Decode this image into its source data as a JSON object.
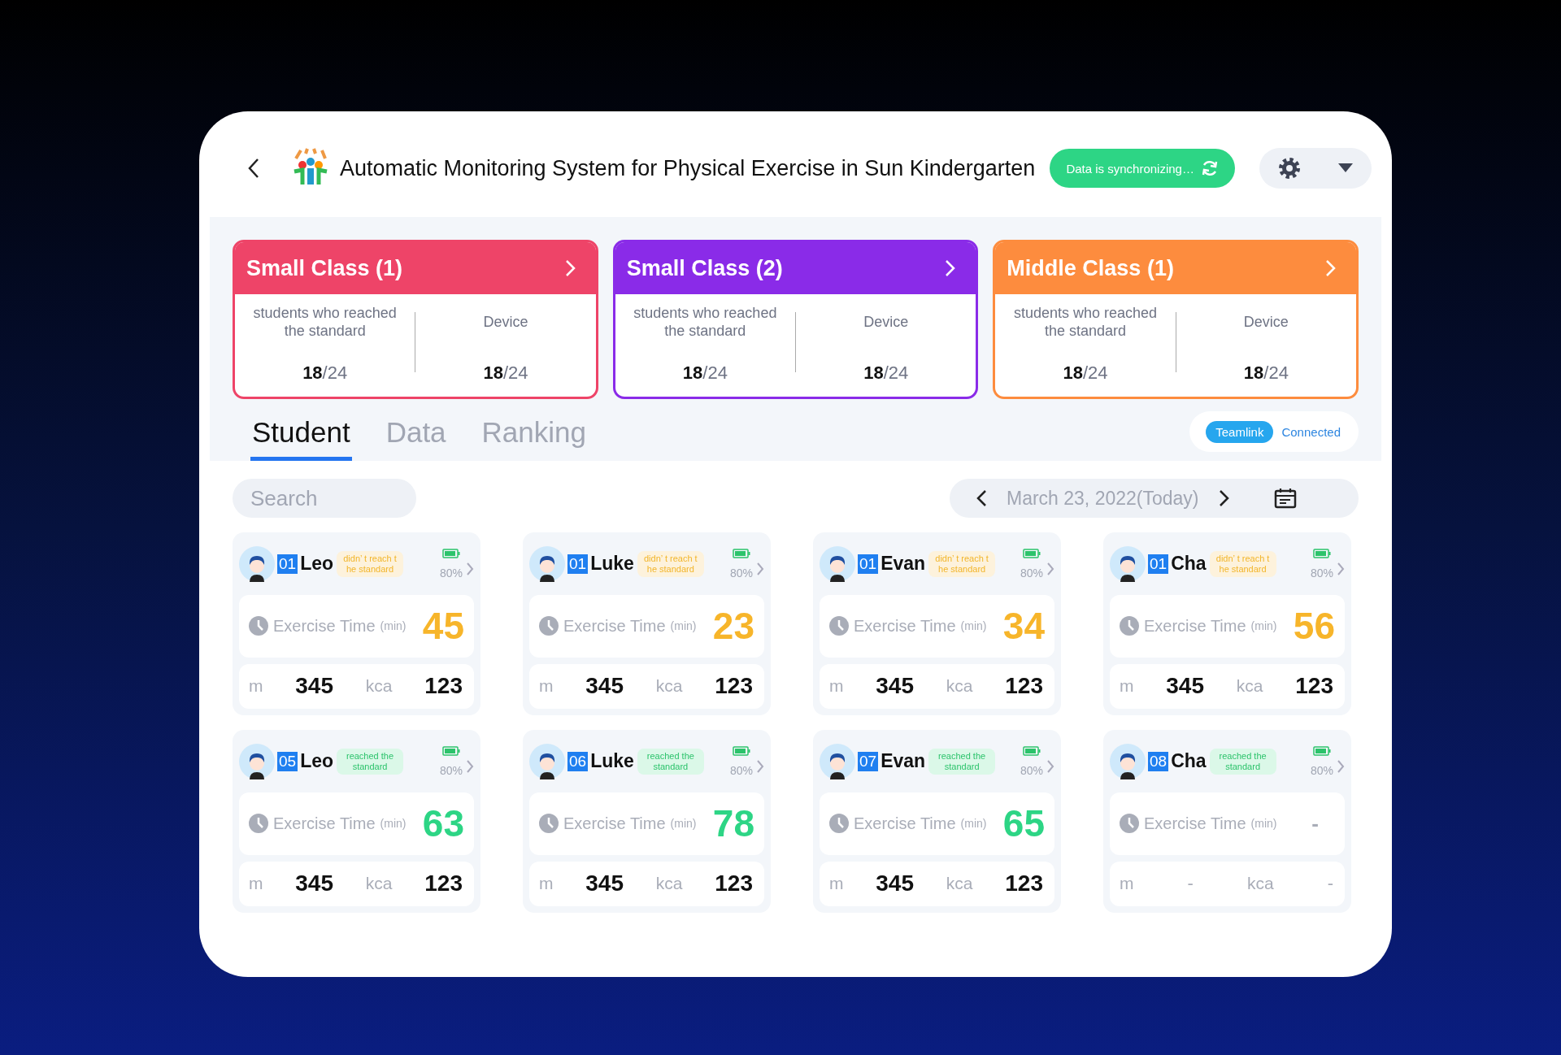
{
  "header": {
    "title": "Automatic Monitoring System for Physical Exercise in Sun Kindergarten",
    "sync_status": "Data is synchronizing…"
  },
  "classes": [
    {
      "name": "Small Class (1)",
      "color": "#ee4468",
      "reached_label": "students who reached the standard",
      "reached": "**18**/24",
      "device_label": "Device",
      "device": "**18**/24"
    },
    {
      "name": "Small Class (2)",
      "color": "#8a2be8",
      "reached_label": "students who reached the standard",
      "reached": "**18**/24",
      "device_label": "Device",
      "device": "**18**/24"
    },
    {
      "name": "Middle Class (1)",
      "color": "#fd8c3e",
      "reached_label": "students who reached the standard",
      "reached": "**18**/24",
      "device_label": "Device",
      "device": "**18**/24"
    }
  ],
  "tabs": [
    {
      "label": "Student",
      "selected": true
    },
    {
      "label": "Data",
      "selected": false
    },
    {
      "label": "Ranking",
      "selected": false
    }
  ],
  "connection": {
    "device": "Teamlink",
    "status": "Connected"
  },
  "search": {
    "placeholder": "Search"
  },
  "date": "March 23, 2022(Today)",
  "students": [
    {
      "number": "01",
      "name": "Leo",
      "reached": false,
      "tag": "didn’ t reach t he standard",
      "battery": "80%",
      "time_label": "Exercise Time",
      "time_unit": "(min)",
      "time": "45",
      "distance_unit": "m",
      "distance": "345",
      "calorie_unit": "kca",
      "calories": "123"
    },
    {
      "number": "01",
      "name": "Luke",
      "reached": false,
      "tag": "didn’ t reach t he standard",
      "battery": "80%",
      "time_label": "Exercise Time",
      "time_unit": "(min)",
      "time": "23",
      "distance_unit": "m",
      "distance": "345",
      "calorie_unit": "kca",
      "calories": "123"
    },
    {
      "number": "01",
      "name": "Evan",
      "reached": false,
      "tag": "didn’ t reach t he standard",
      "battery": "80%",
      "time_label": "Exercise Time",
      "time_unit": "(min)",
      "time": "34",
      "distance_unit": "m",
      "distance": "345",
      "calorie_unit": "kca",
      "calories": "123"
    },
    {
      "number": "01",
      "name": "Cha",
      "reached": false,
      "tag": "didn’ t reach t he standard",
      "battery": "80%",
      "time_label": "Exercise Time",
      "time_unit": "(min)",
      "time": "56",
      "distance_unit": "m",
      "distance": "345",
      "calorie_unit": "kca",
      "calories": "123"
    },
    {
      "number": "05",
      "name": "Leo",
      "reached": true,
      "tag": "reached the standard",
      "battery": "80%",
      "time_label": "Exercise Time",
      "time_unit": "(min)",
      "time": "63",
      "distance_unit": "m",
      "distance": "345",
      "calorie_unit": "kca",
      "calories": "123"
    },
    {
      "number": "06",
      "name": "Luke",
      "reached": true,
      "tag": "reached the standard",
      "battery": "80%",
      "time_label": "Exercise Time",
      "time_unit": "(min)",
      "time": "78",
      "distance_unit": "m",
      "distance": "345",
      "calorie_unit": "kca",
      "calories": "123"
    },
    {
      "number": "07",
      "name": "Evan",
      "reached": true,
      "tag": "reached the standard",
      "battery": "80%",
      "time_label": "Exercise Time",
      "time_unit": "(min)",
      "time": "65",
      "distance_unit": "m",
      "distance": "345",
      "calorie_unit": "kca",
      "calories": "123"
    },
    {
      "number": "08",
      "name": "Cha",
      "reached": true,
      "tag": "reached the standard",
      "battery": "80%",
      "time_label": "Exercise Time",
      "time_unit": "(min)",
      "time": "-",
      "distance_unit": "m",
      "distance": "-",
      "calorie_unit": "kca",
      "calories": "-"
    }
  ]
}
